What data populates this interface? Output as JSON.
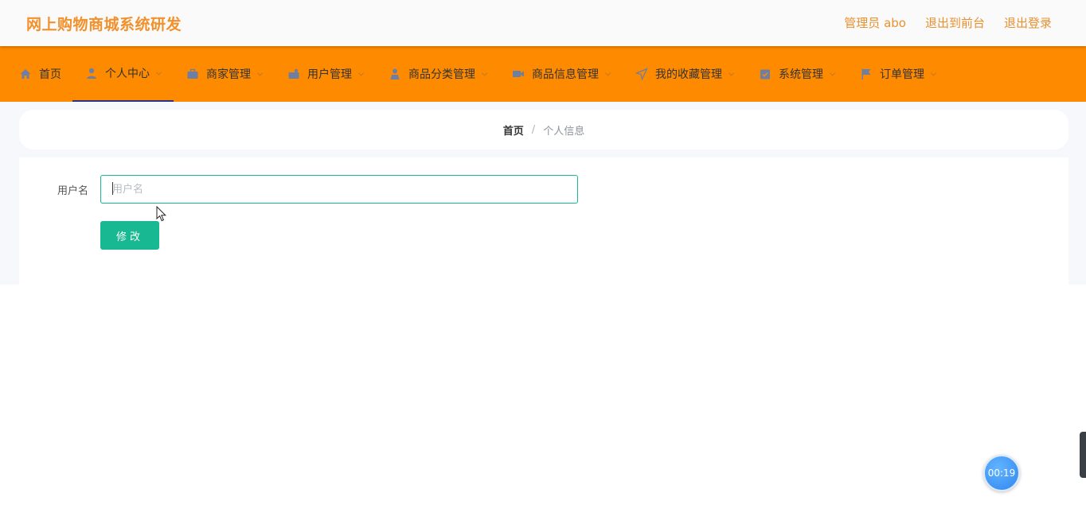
{
  "header": {
    "title": "网上购物商城系统研发",
    "links": [
      "管理员 abo",
      "退出到前台",
      "退出登录"
    ]
  },
  "nav": {
    "items": [
      {
        "label": "首页",
        "icon": "home-icon",
        "has_submenu": false,
        "active": false
      },
      {
        "label": "个人中心",
        "icon": "user-icon",
        "has_submenu": true,
        "active": true
      },
      {
        "label": "商家管理",
        "icon": "briefcase-icon",
        "has_submenu": true,
        "active": false
      },
      {
        "label": "用户管理",
        "icon": "users-icon",
        "has_submenu": true,
        "active": false
      },
      {
        "label": "商品分类管理",
        "icon": "person-icon",
        "has_submenu": true,
        "active": false
      },
      {
        "label": "商品信息管理",
        "icon": "video-icon",
        "has_submenu": true,
        "active": false
      },
      {
        "label": "我的收藏管理",
        "icon": "send-icon",
        "has_submenu": true,
        "active": false
      },
      {
        "label": "系统管理",
        "icon": "clipboard-check-icon",
        "has_submenu": true,
        "active": false
      },
      {
        "label": "订单管理",
        "icon": "flag-icon",
        "has_submenu": true,
        "active": false
      }
    ],
    "colors": {
      "background": "#fe8a00",
      "active_indicator": "#2b3380"
    }
  },
  "breadcrumb": {
    "home": "首页",
    "separator": "/",
    "current": "个人信息"
  },
  "form": {
    "username_label": "用户名",
    "username_value": "",
    "username_placeholder": "用户名",
    "submit_label": "修改"
  },
  "timer": {
    "value": "00:19"
  },
  "colors": {
    "accent": "#17b892",
    "title": "#f2902b"
  }
}
